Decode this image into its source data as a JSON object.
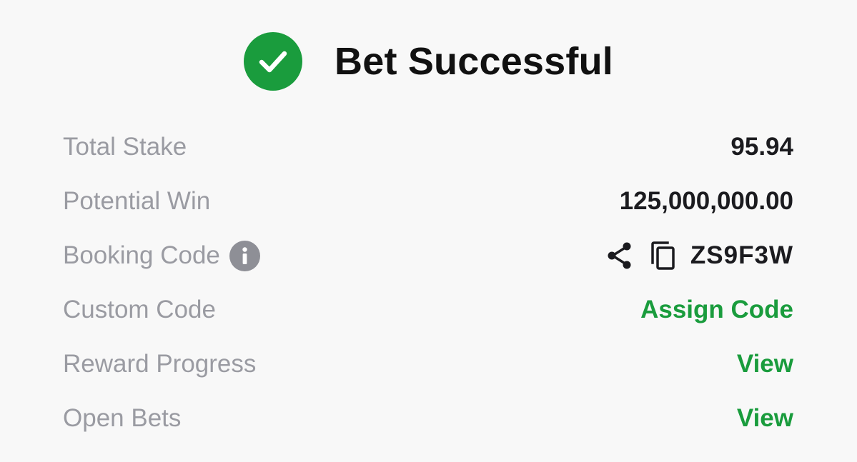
{
  "header": {
    "title": "Bet Successful"
  },
  "rows": {
    "total_stake": {
      "label": "Total Stake",
      "value": "95.94"
    },
    "potential_win": {
      "label": "Potential Win",
      "value": "125,000,000.00"
    },
    "booking_code": {
      "label": "Booking Code",
      "value": "ZS9F3W"
    },
    "custom_code": {
      "label": "Custom Code",
      "action": "Assign Code"
    },
    "reward_progress": {
      "label": "Reward Progress",
      "action": "View"
    },
    "open_bets": {
      "label": "Open Bets",
      "action": "View"
    }
  },
  "icons": {
    "success": "check-circle-icon",
    "info": "info-icon",
    "share": "share-icon",
    "copy": "copy-icon"
  },
  "colors": {
    "accent": "#1a9c3d",
    "label": "#9a9ba2",
    "value": "#1b1b1f",
    "background": "#f8f8f8"
  }
}
